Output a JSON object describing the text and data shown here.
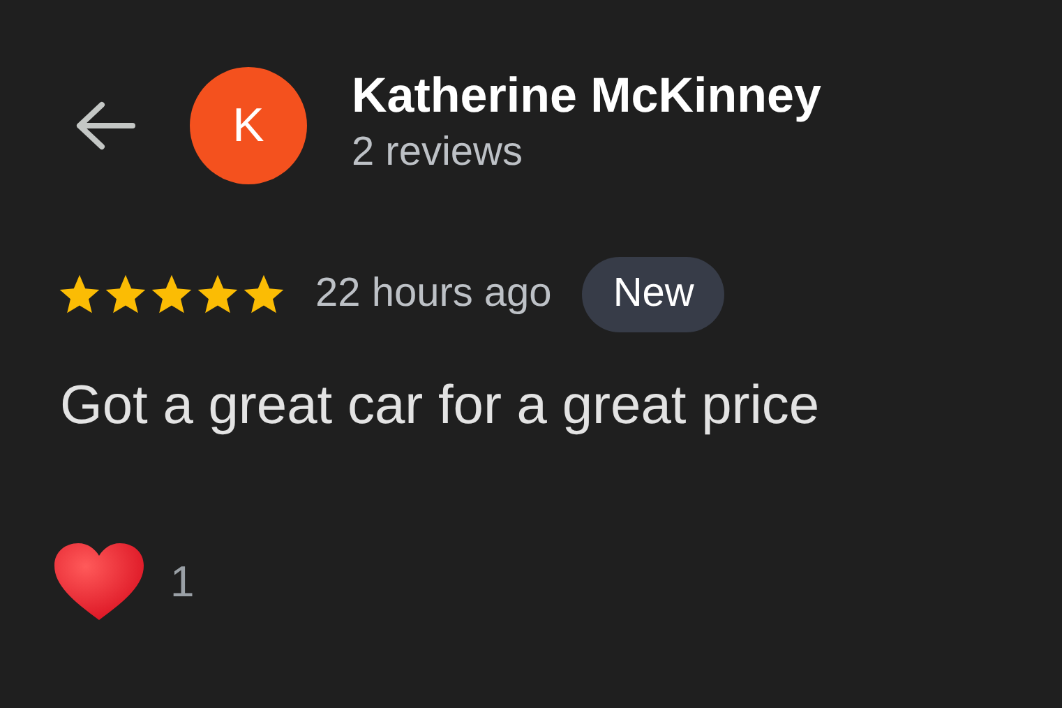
{
  "reviewer": {
    "initial": "K",
    "name": "Katherine McKinney",
    "review_count": "2 reviews"
  },
  "review": {
    "stars": 5,
    "time": "22 hours ago",
    "badge": "New",
    "text": "Got a great car for a great price"
  },
  "reactions": {
    "count": "1"
  }
}
